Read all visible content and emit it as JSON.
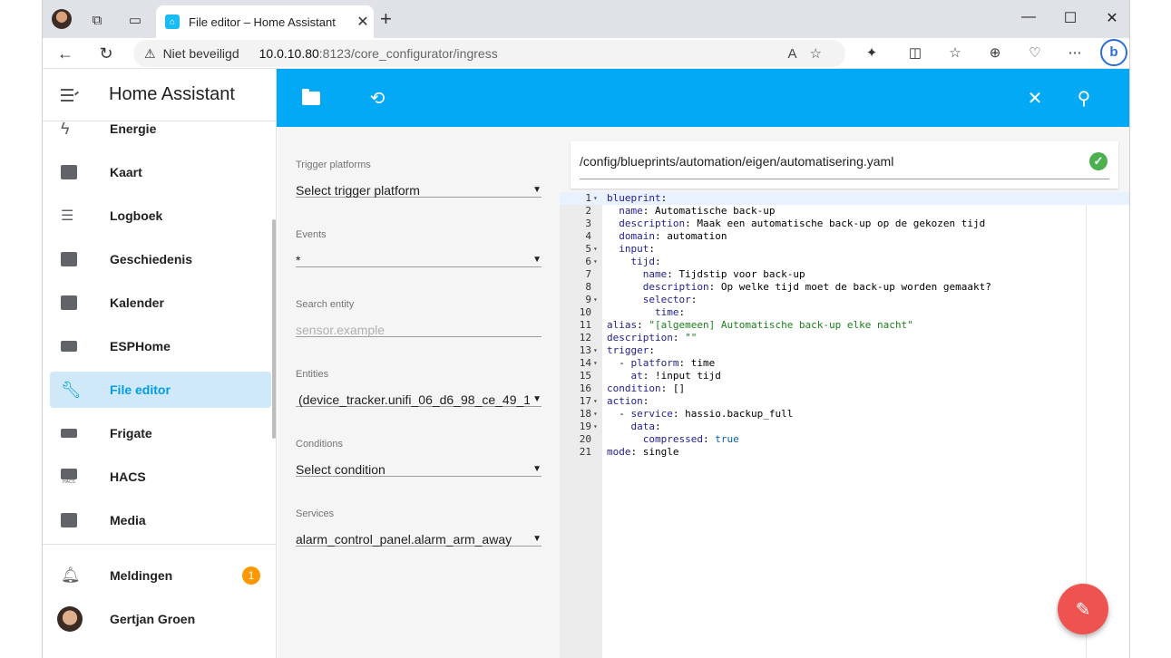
{
  "browser": {
    "tab_title": "File editor – Home Assistant",
    "security_label": "Niet beveiligd",
    "url_host": "10.0.10.80",
    "url_path": ":8123/core_configurator/ingress"
  },
  "sidebar": {
    "title": "Home Assistant",
    "items": [
      {
        "label": "Energie",
        "icon": "lightning-icon"
      },
      {
        "label": "Kaart",
        "icon": "map-icon"
      },
      {
        "label": "Logboek",
        "icon": "list-icon"
      },
      {
        "label": "Geschiedenis",
        "icon": "chart-icon"
      },
      {
        "label": "Kalender",
        "icon": "calendar-icon"
      },
      {
        "label": "ESPHome",
        "icon": "chip-icon"
      },
      {
        "label": "File editor",
        "icon": "wrench-icon"
      },
      {
        "label": "Frigate",
        "icon": "cctv-icon"
      },
      {
        "label": "HACS",
        "icon": "store-icon"
      },
      {
        "label": "Media",
        "icon": "media-icon"
      }
    ],
    "notifications_label": "Meldingen",
    "notifications_count": "1",
    "user_name": "Gertjan Groen",
    "hacs_small": "HACS"
  },
  "form": {
    "trigger_label": "Trigger platforms",
    "trigger_value": "Select trigger platform",
    "events_label": "Events",
    "events_value": "*",
    "search_label": "Search entity",
    "search_placeholder": "sensor.example",
    "entities_label": "Entities",
    "entities_value": "(device_tracker.unifi_06_d6_98_ce_49_1…",
    "conditions_label": "Conditions",
    "conditions_value": "Select condition",
    "services_label": "Services",
    "services_value": "alarm_control_panel.alarm_arm_away"
  },
  "editor": {
    "file_path": "/config/blueprints/automation/eigen/automatisering.yaml",
    "lines": [
      {
        "n": "1",
        "fold": true,
        "text": "blueprint:"
      },
      {
        "n": "2",
        "fold": false,
        "text": "  name: Automatische back-up"
      },
      {
        "n": "3",
        "fold": false,
        "text": "  description: Maak een automatische back-up op de gekozen tijd"
      },
      {
        "n": "4",
        "fold": false,
        "text": "  domain: automation"
      },
      {
        "n": "5",
        "fold": true,
        "text": "  input:"
      },
      {
        "n": "6",
        "fold": true,
        "text": "    tijd:"
      },
      {
        "n": "7",
        "fold": false,
        "text": "      name: Tijdstip voor back-up"
      },
      {
        "n": "8",
        "fold": false,
        "text": "      description: Op welke tijd moet de back-up worden gemaakt?"
      },
      {
        "n": "9",
        "fold": true,
        "text": "      selector:"
      },
      {
        "n": "10",
        "fold": false,
        "text": "        time:"
      },
      {
        "n": "11",
        "fold": false,
        "text": "alias: \"[algemeen] Automatische back-up elke nacht\""
      },
      {
        "n": "12",
        "fold": false,
        "text": "description: \"\""
      },
      {
        "n": "13",
        "fold": true,
        "text": "trigger:"
      },
      {
        "n": "14",
        "fold": true,
        "text": "  - platform: time"
      },
      {
        "n": "15",
        "fold": false,
        "text": "    at: !input tijd"
      },
      {
        "n": "16",
        "fold": false,
        "text": "condition: []"
      },
      {
        "n": "17",
        "fold": true,
        "text": "action:"
      },
      {
        "n": "18",
        "fold": true,
        "text": "  - service: hassio.backup_full"
      },
      {
        "n": "19",
        "fold": true,
        "text": "    data:"
      },
      {
        "n": "20",
        "fold": false,
        "text": "      compressed: true"
      },
      {
        "n": "21",
        "fold": false,
        "text": "mode: single"
      }
    ]
  },
  "colors": {
    "accent": "#03a9f4",
    "active_item_bg": "#cfe9f9",
    "fab": "#ef5350",
    "badge": "#ff9800",
    "saved_check": "#4caf50"
  }
}
